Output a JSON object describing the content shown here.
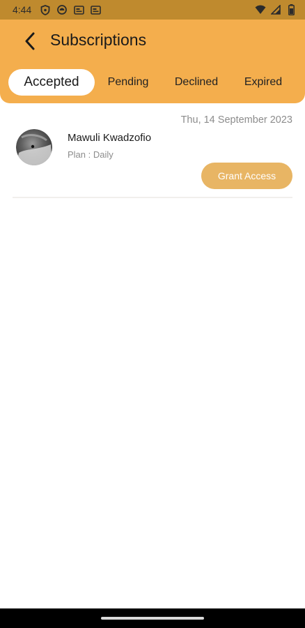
{
  "status_bar": {
    "time": "4:44",
    "left_icons": [
      "shield-icon",
      "android-icon",
      "sim-card-icon",
      "sim-card-icon"
    ],
    "right_icons": [
      "wifi-icon",
      "signal-icon",
      "battery-icon"
    ]
  },
  "header": {
    "title": "Subscriptions",
    "background_color": "#f4ae4d"
  },
  "tabs": [
    {
      "label": "Accepted",
      "active": true
    },
    {
      "label": "Pending",
      "active": false
    },
    {
      "label": "Declined",
      "active": false
    },
    {
      "label": "Expired",
      "active": false
    }
  ],
  "subscriptions": [
    {
      "date": "Thu, 14 September 2023",
      "name": "Mawuli Kwadzofio",
      "plan": "Plan : Daily",
      "action_label": "Grant Access",
      "action_color": "#e8b564"
    }
  ]
}
